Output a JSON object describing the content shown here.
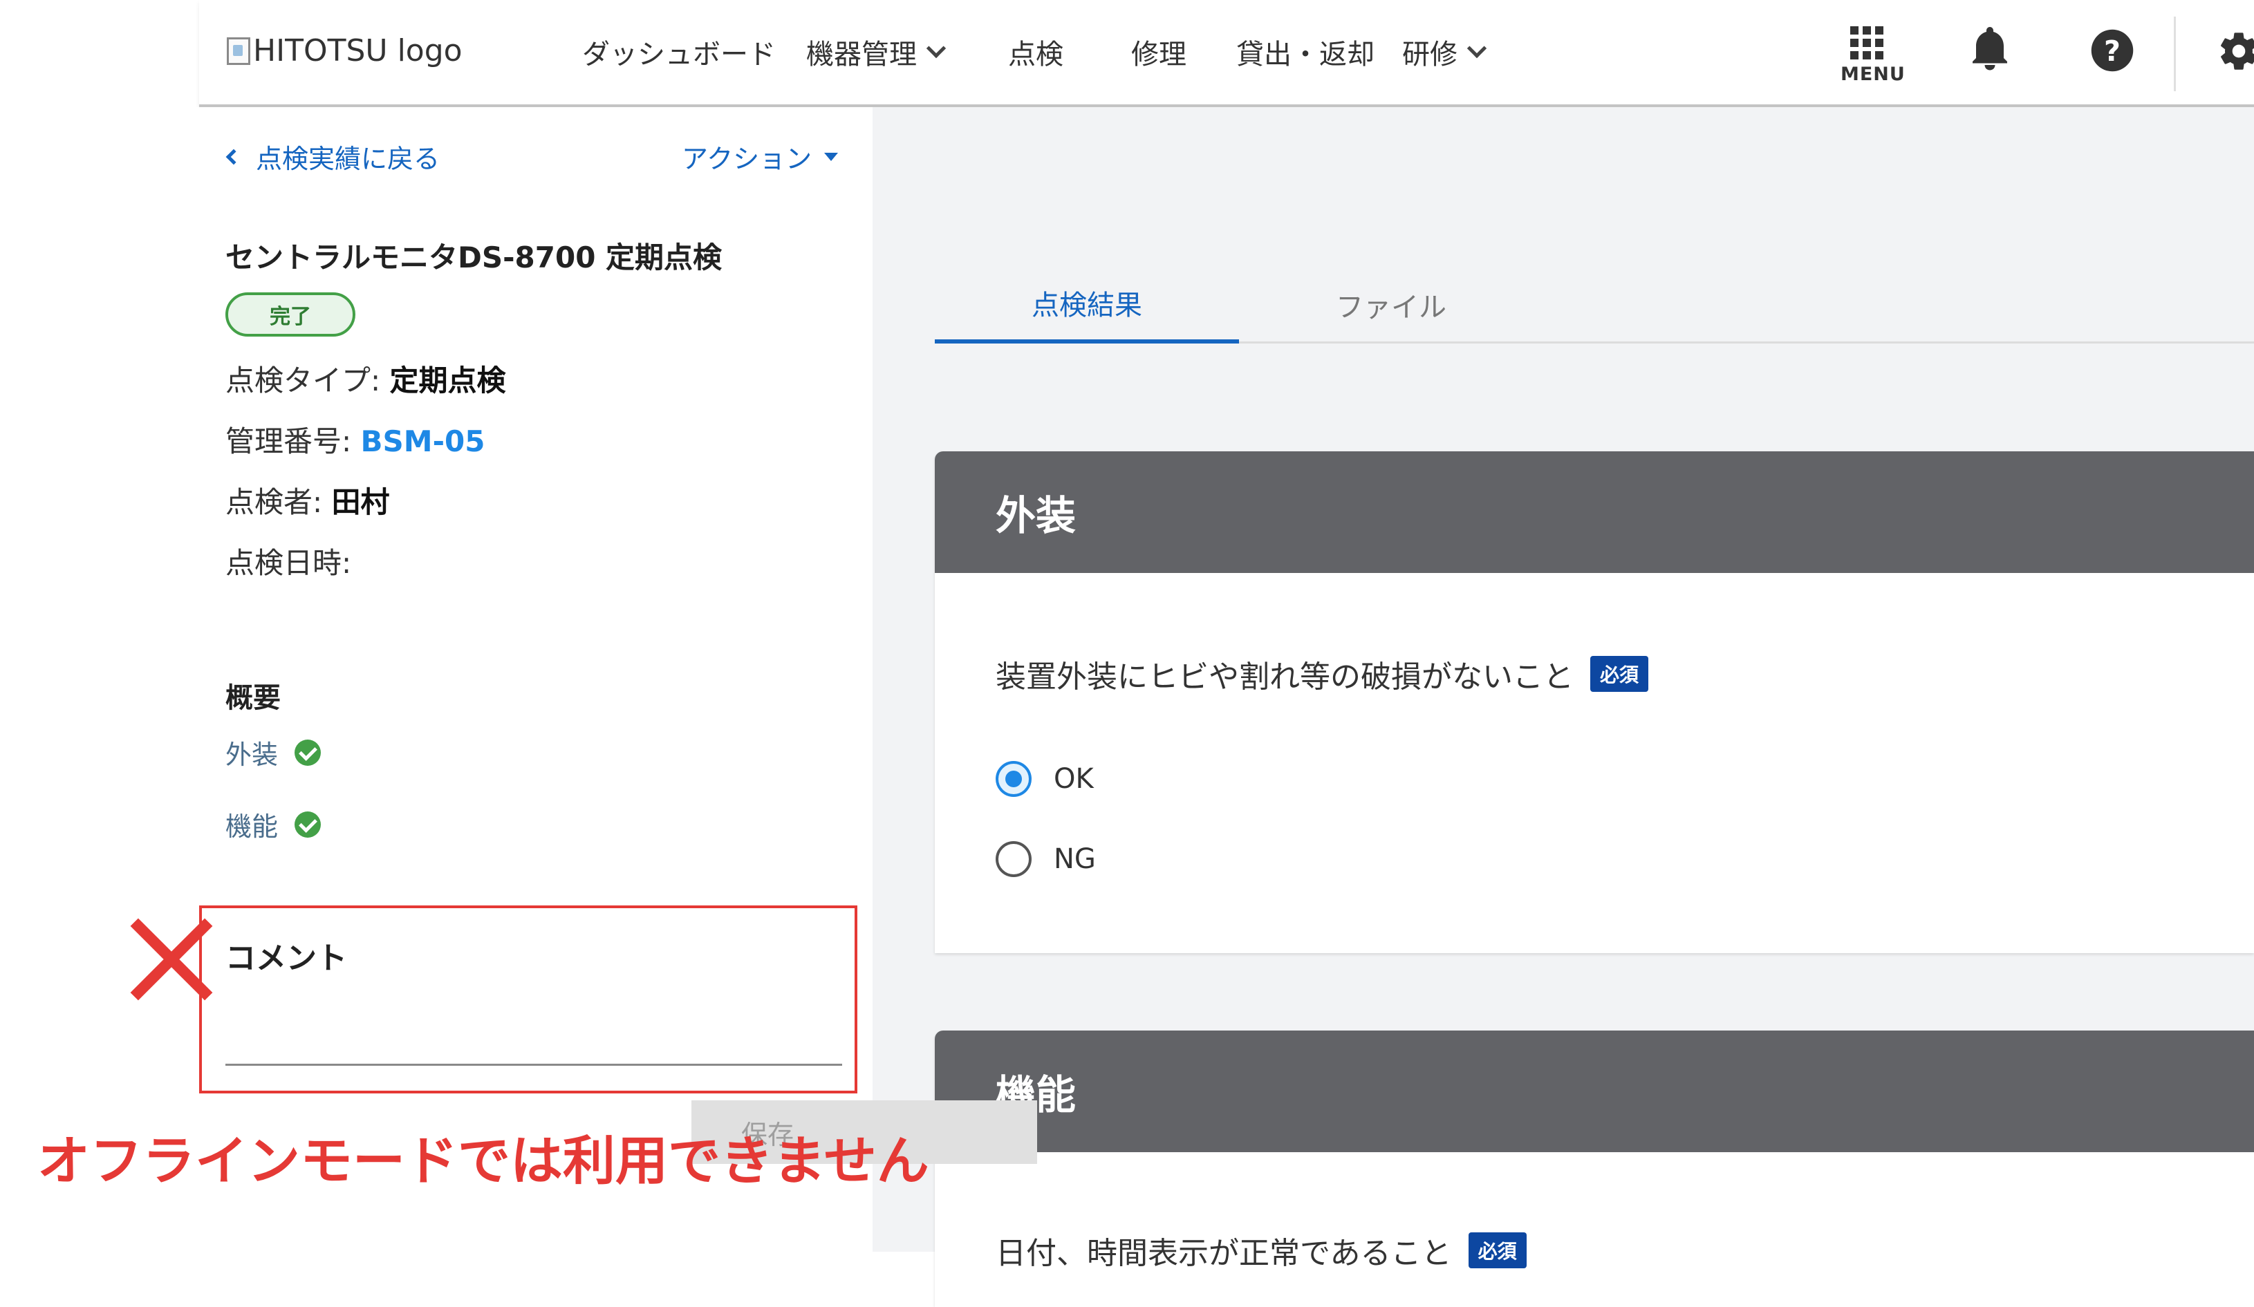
{
  "header": {
    "logo_alt": "HITOTSU logo",
    "nav": [
      {
        "label": "ダッシュボード"
      },
      {
        "label": "機器管理"
      },
      {
        "label": "点検"
      },
      {
        "label": "修理"
      },
      {
        "label": "貸出・返却"
      },
      {
        "label": "研修"
      }
    ],
    "menu_label": "MENU"
  },
  "left": {
    "back_label": "点検実績に戻る",
    "action_label": "アクション",
    "title": "セントラルモニタDS-8700 定期点検",
    "status": "完了",
    "info": {
      "type_label": "点検タイプ: ",
      "type_value": "定期点検",
      "id_label": "管理番号: ",
      "id_value": "BSM-05",
      "inspector_label": "点検者: ",
      "inspector_value": "田村",
      "date_label": "点検日時:"
    },
    "summary": {
      "heading": "概要",
      "items": [
        {
          "label": "外装"
        },
        {
          "label": "機能"
        }
      ]
    },
    "comment": {
      "label": "コメント",
      "value": "",
      "save_label": "保存"
    },
    "offline_message": "オフラインモードでは利用できません"
  },
  "right": {
    "tabs": [
      {
        "label": "点検結果"
      },
      {
        "label": "ファイル"
      }
    ],
    "cards": [
      {
        "title": "外装",
        "question": "装置外装にヒビや割れ等の破損がないこと",
        "required": "必須",
        "options": [
          {
            "label": "OK",
            "selected": true
          },
          {
            "label": "NG",
            "selected": false
          }
        ]
      },
      {
        "title": "機能",
        "question": "日付、時間表示が正常であること",
        "required": "必須"
      }
    ]
  }
}
